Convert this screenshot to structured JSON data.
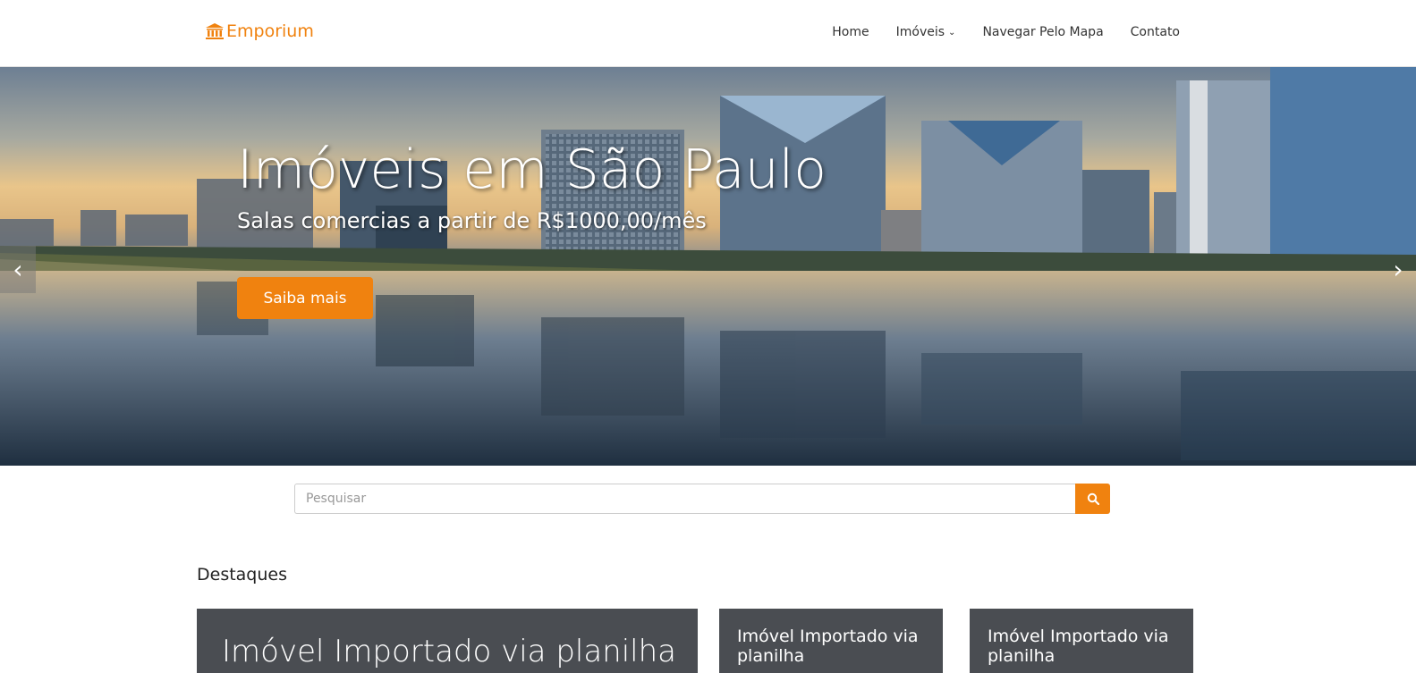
{
  "header": {
    "brand": "Emporium",
    "nav": [
      {
        "label": "Home"
      },
      {
        "label": "Imóveis",
        "has_dropdown": true
      },
      {
        "label": "Navegar Pelo Mapa"
      },
      {
        "label": "Contato"
      }
    ]
  },
  "hero": {
    "title": "Imóveis em São Paulo",
    "subtitle": "Salas comercias a partir de R$1000,00/mês",
    "cta": "Saiba mais",
    "prev_icon": "‹",
    "next_icon": "›"
  },
  "search": {
    "placeholder": "Pesquisar",
    "icon": "search-icon"
  },
  "featured": {
    "title": "Destaques",
    "cards": [
      {
        "title": "Imóvel Importado via planilha"
      },
      {
        "title": "Imóvel Importado via planilha"
      },
      {
        "title": "Imóvel Importado via planilha"
      }
    ]
  },
  "colors": {
    "accent": "#f0820f",
    "card_bg": "#4a4d52"
  }
}
